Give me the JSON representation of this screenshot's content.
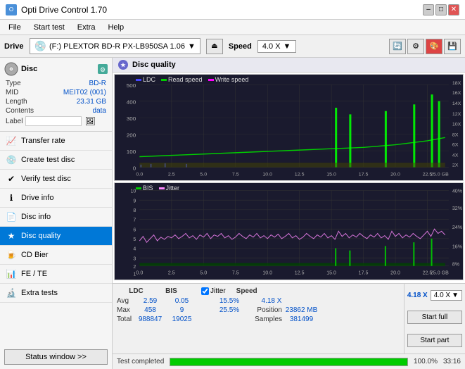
{
  "app": {
    "title": "Opti Drive Control 1.70",
    "icon": "O"
  },
  "titlebar": {
    "minimize": "–",
    "maximize": "□",
    "close": "✕"
  },
  "menu": {
    "items": [
      "File",
      "Start test",
      "Extra",
      "Help"
    ]
  },
  "drivebar": {
    "drive_label": "Drive",
    "drive_value": "(F:)  PLEXTOR BD-R  PX-LB950SA 1.06",
    "speed_label": "Speed",
    "speed_value": "4.0 X"
  },
  "disc": {
    "type_label": "Type",
    "type_value": "BD-R",
    "mid_label": "MID",
    "mid_value": "MEIT02 (001)",
    "length_label": "Length",
    "length_value": "23.31 GB",
    "contents_label": "Contents",
    "contents_value": "data",
    "label_label": "Label",
    "label_value": ""
  },
  "nav": {
    "items": [
      {
        "id": "transfer-rate",
        "label": "Transfer rate",
        "icon": "📈"
      },
      {
        "id": "create-test-disc",
        "label": "Create test disc",
        "icon": "💿"
      },
      {
        "id": "verify-test-disc",
        "label": "Verify test disc",
        "icon": "✔"
      },
      {
        "id": "drive-info",
        "label": "Drive info",
        "icon": "ℹ"
      },
      {
        "id": "disc-info",
        "label": "Disc info",
        "icon": "📄"
      },
      {
        "id": "disc-quality",
        "label": "Disc quality",
        "icon": "★",
        "active": true
      },
      {
        "id": "cd-bier",
        "label": "CD Bier",
        "icon": "🍺"
      },
      {
        "id": "fe-te",
        "label": "FE / TE",
        "icon": "📊"
      },
      {
        "id": "extra-tests",
        "label": "Extra tests",
        "icon": "🔬"
      }
    ]
  },
  "status_btn": "Status window >>",
  "disc_quality": {
    "title": "Disc quality",
    "legend": [
      {
        "label": "LDC",
        "color": "#4444ff"
      },
      {
        "label": "Read speed",
        "color": "#00cc00"
      },
      {
        "label": "Write speed",
        "color": "#ff00ff"
      }
    ],
    "legend2": [
      {
        "label": "BIS",
        "color": "#00cc00"
      },
      {
        "label": "Jitter",
        "color": "#ff88ff"
      }
    ]
  },
  "chart1": {
    "y_labels_left": [
      "500",
      "400",
      "300",
      "200",
      "100",
      "0"
    ],
    "y_labels_right": [
      "18X",
      "16X",
      "14X",
      "12X",
      "10X",
      "8X",
      "6X",
      "4X",
      "2X"
    ],
    "x_labels": [
      "0.0",
      "2.5",
      "5.0",
      "7.5",
      "10.0",
      "12.5",
      "15.0",
      "17.5",
      "20.0",
      "22.5",
      "25.0 GB"
    ]
  },
  "chart2": {
    "y_labels_left": [
      "10",
      "9",
      "8",
      "7",
      "6",
      "5",
      "4",
      "3",
      "2",
      "1"
    ],
    "y_labels_right": [
      "40%",
      "32%",
      "24%",
      "16%",
      "8%"
    ],
    "x_labels": [
      "0.0",
      "2.5",
      "5.0",
      "7.5",
      "10.0",
      "12.5",
      "15.0",
      "17.5",
      "20.0",
      "22.5",
      "25.0 GB"
    ]
  },
  "stats": {
    "headers": [
      "LDC",
      "BIS",
      "",
      "Jitter",
      "Speed",
      ""
    ],
    "avg_label": "Avg",
    "avg_ldc": "2.59",
    "avg_bis": "0.05",
    "avg_jitter": "15.5%",
    "avg_speed": "4.18 X",
    "max_label": "Max",
    "max_ldc": "458",
    "max_bis": "9",
    "max_jitter": "25.5%",
    "max_position_label": "Position",
    "max_position": "23862 MB",
    "total_label": "Total",
    "total_ldc": "988847",
    "total_bis": "19025",
    "total_samples_label": "Samples",
    "total_samples": "381499",
    "jitter_checked": true,
    "speed_display": "4.0 X"
  },
  "buttons": {
    "start_full": "Start full",
    "start_part": "Start part"
  },
  "progress": {
    "status_text": "Test completed",
    "percent": 100,
    "percent_display": "100.0%",
    "time": "33:16"
  }
}
